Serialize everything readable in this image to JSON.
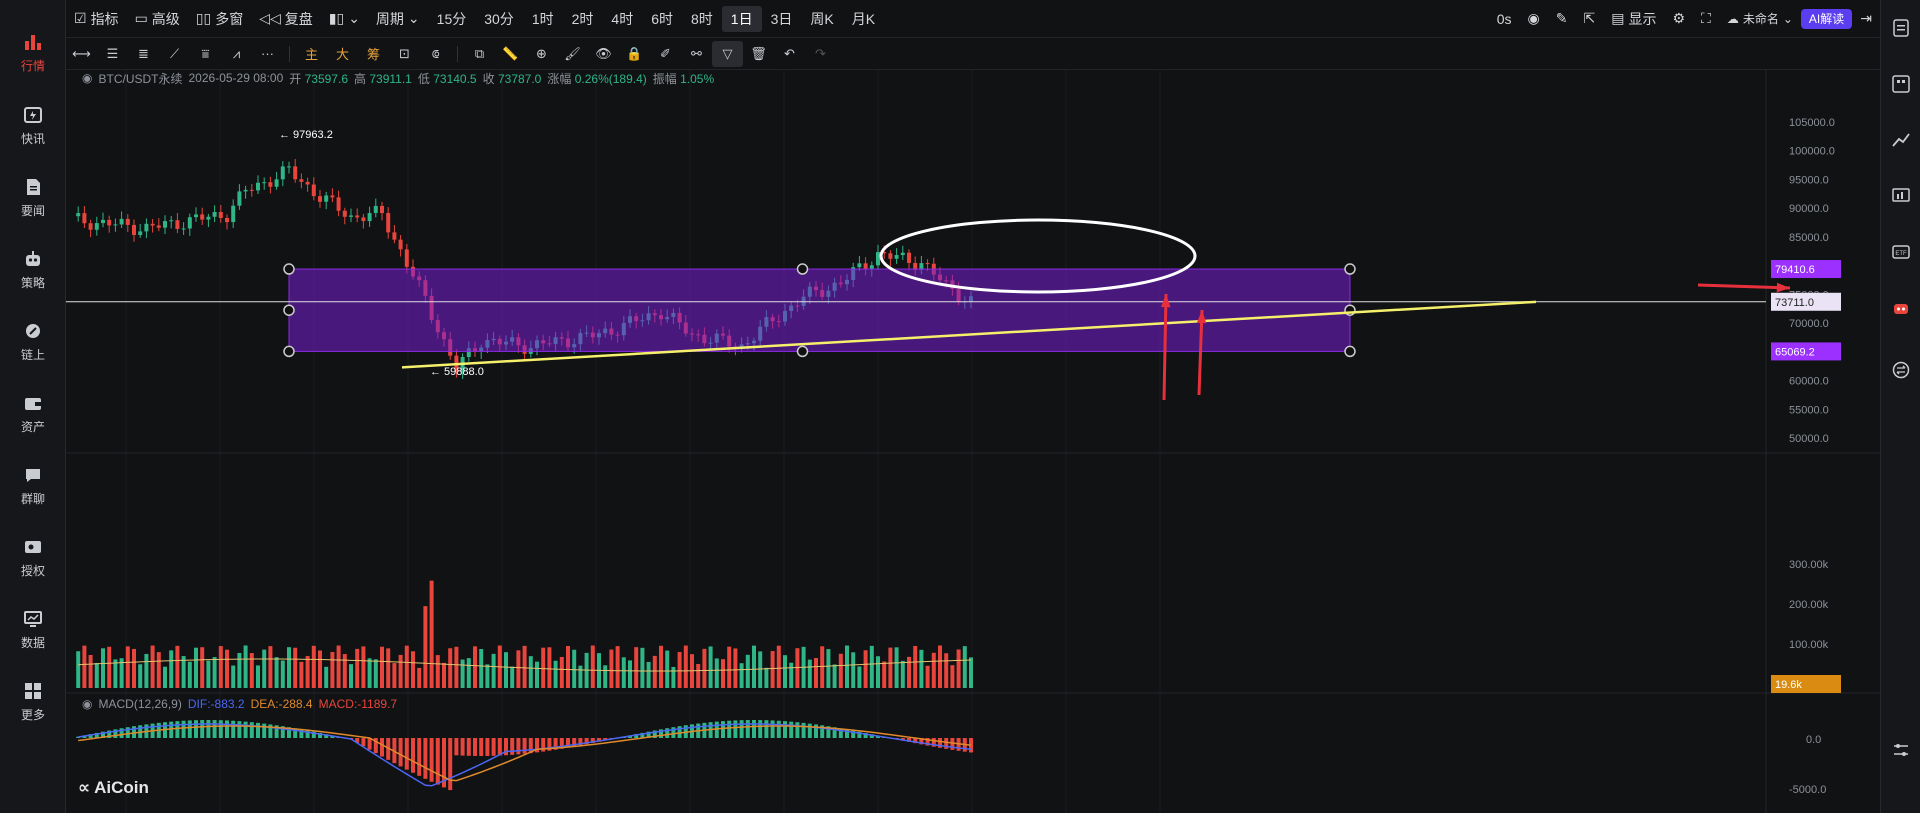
{
  "sidebar": {
    "items": [
      {
        "label": "行情",
        "icon": "chart-bars-icon",
        "active": true
      },
      {
        "label": "快讯",
        "icon": "flash-news-icon"
      },
      {
        "label": "要闻",
        "icon": "document-icon"
      },
      {
        "label": "策略",
        "icon": "robot-icon"
      },
      {
        "label": "链上",
        "icon": "chain-icon"
      },
      {
        "label": "资产",
        "icon": "wallet-icon"
      },
      {
        "label": "群聊",
        "icon": "chat-icon"
      },
      {
        "label": "授权",
        "icon": "key-icon"
      },
      {
        "label": "数据",
        "icon": "monitor-icon"
      },
      {
        "label": "更多",
        "icon": "grid-icon"
      }
    ]
  },
  "topbar": {
    "indicator": "指标",
    "advanced": "高级",
    "multi": "多窗",
    "replay": "复盘",
    "period": "周期",
    "timeframes": [
      "15分",
      "30分",
      "1时",
      "2时",
      "4时",
      "6时",
      "8时",
      "1日",
      "3日",
      "周K",
      "月K"
    ],
    "selected_timeframe": "1日",
    "countdown": "0s",
    "display": "显示",
    "layout_name": "未命名",
    "ai_button": "AI解读"
  },
  "infobar": {
    "symbol": "BTC/USDT永续",
    "datetime": "2026-05-29 08:00",
    "open_label": "开",
    "open": "73597.6",
    "high_label": "高",
    "high": "73911.1",
    "low_label": "低",
    "low": "73140.5",
    "close_label": "收",
    "close": "73787.0",
    "change_label": "涨幅",
    "change": "0.26%(189.4)",
    "amp_label": "振幅",
    "amp": "1.05%"
  },
  "price_axis": {
    "ticks": [
      "105000.0",
      "100000.0",
      "95000.0",
      "90000.0",
      "85000.0",
      "80000.0",
      "75000.0",
      "70000.0",
      "65000.0",
      "60000.0",
      "55000.0",
      "50000.0"
    ],
    "box_top_label": "79410.6",
    "box_bottom_label": "65069.2",
    "current_label": "73711.0",
    "accent": "#9b30ff"
  },
  "volume_axis": {
    "ticks": [
      "300.00k",
      "200.00k",
      "100.00k"
    ],
    "current_label": "19.6k"
  },
  "macd": {
    "name": "MACD(12,26,9)",
    "dif": "DIF:-883.2",
    "dea": "DEA:-288.4",
    "macd": "MACD:-1189.7",
    "zero_label": "0.0",
    "low_label": "-5000.0"
  },
  "annotations": {
    "high": "97963.2",
    "low": "59888.0"
  },
  "brand": "AiCoin",
  "colors": {
    "up": "#2fb586",
    "down": "#e8453c",
    "box": "#8a2be2",
    "trend": "#f5f06c"
  }
}
